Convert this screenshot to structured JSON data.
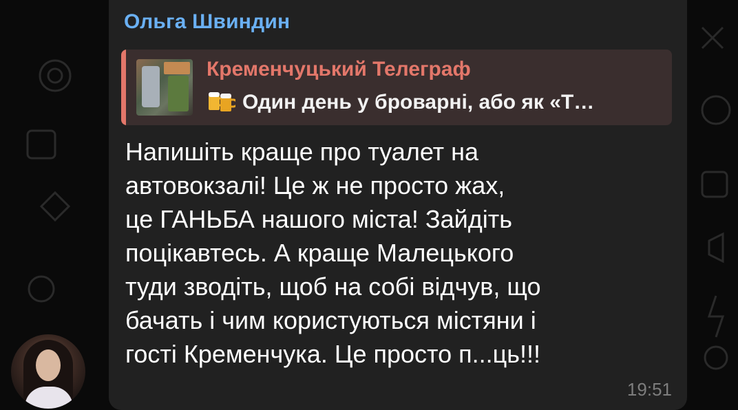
{
  "message": {
    "sender_name": "Ольга Швиндин",
    "reply": {
      "title": "Кременчуцький Телеграф",
      "text": "Один день у броварні, або як «Т…",
      "emoji": "beer-mugs-icon"
    },
    "text": "Напишіть краще про туалет на\nавтовокзалі! Це ж не просто жах,\nце ГАНЬБА нашого міста! Зайдіть\nпоцікавтесь. А краще  Малецького\nтуди зводіть, щоб на собі відчув, що\nбачать і чим користуються містяни і\nгості Кременчука. Це просто п...ць!!!",
    "time": "19:51"
  },
  "colors": {
    "background": "#0a0a0a",
    "bubble": "#212121",
    "sender": "#6ab0f3",
    "reply_accent": "#e3776a",
    "reply_background": "#3a2e2e",
    "text": "#ffffff",
    "time": "#7d7d7d"
  }
}
